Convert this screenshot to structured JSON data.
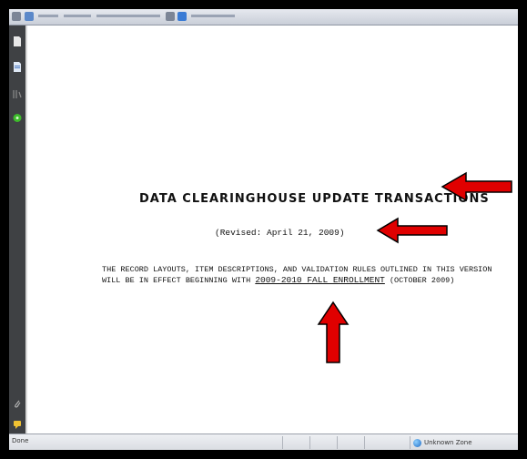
{
  "document": {
    "title": "DATA CLEARINGHOUSE UPDATE TRANSACTIONS",
    "revised": "(Revised:  April 21, 2009)",
    "paragraph": {
      "line1": "THE RECORD LAYOUTS, ITEM DESCRIPTIONS, AND VALIDATION RULES OUTLINED IN THIS VERSION",
      "line2_prefix": "WILL BE IN EFFECT BEGINNING WITH ",
      "line2_underlined": "2009-2010 FALL ENROLLMENT",
      "line2_suffix": " (OCTOBER 2009)"
    }
  },
  "statusbar": {
    "left_text": "Done",
    "zone_text": "Unknown Zone"
  },
  "icons": {
    "sidebar": [
      "page-icon",
      "document-icon",
      "bookmarks-icon",
      "green-circle-icon",
      "paperclip-icon",
      "comment-icon"
    ],
    "zone": "globe-icon"
  },
  "colors": {
    "arrow": "#e00000",
    "sidebar": "#3f4144",
    "frame": "#000000"
  }
}
